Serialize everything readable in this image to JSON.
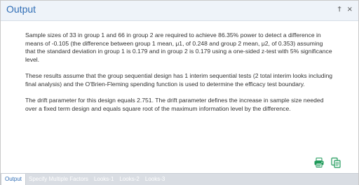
{
  "window": {
    "title": "Output",
    "controls": {
      "pin": "†",
      "close": "×"
    }
  },
  "report": {
    "paragraphs": [
      "Sample sizes of 33 in group 1 and 66 in group 2 are required to achieve 86.35% power to detect a difference in means of -0.105 (the difference between group 1 mean, μ1, of 0.248 and group 2 mean, μ2, of 0.353) assuming that the standard deviation in group 1 is 0.179 and in group 2 is 0.179 using a one-sided z-test with 5% significance level.",
      "These results assume that the group sequential design has 1 interim sequential tests (2 total interim looks including final analysis) and the O'Brien-Fleming spending function is used to determine the efficacy test boundary.",
      "The drift parameter for this design equals 2.751. The drift parameter defines the increase in sample size needed over a fixed term design and equals square root of the maximum information level by the difference."
    ]
  },
  "actions": {
    "print_icon": "printer-icon",
    "copy_icon": "copy-icon"
  },
  "tabs": [
    {
      "label": "Output",
      "active": true
    },
    {
      "label": "Specify Multiple Factors",
      "active": false
    },
    {
      "label": "Looks-1",
      "active": false
    },
    {
      "label": "Looks-2",
      "active": false
    },
    {
      "label": "Looks-3",
      "active": false
    }
  ],
  "colors": {
    "title_blue": "#2f6db5",
    "titlebar_bg": "#eef3f9",
    "tabbar_bg": "#d9dde3",
    "action_green": "#1f9a5a"
  }
}
